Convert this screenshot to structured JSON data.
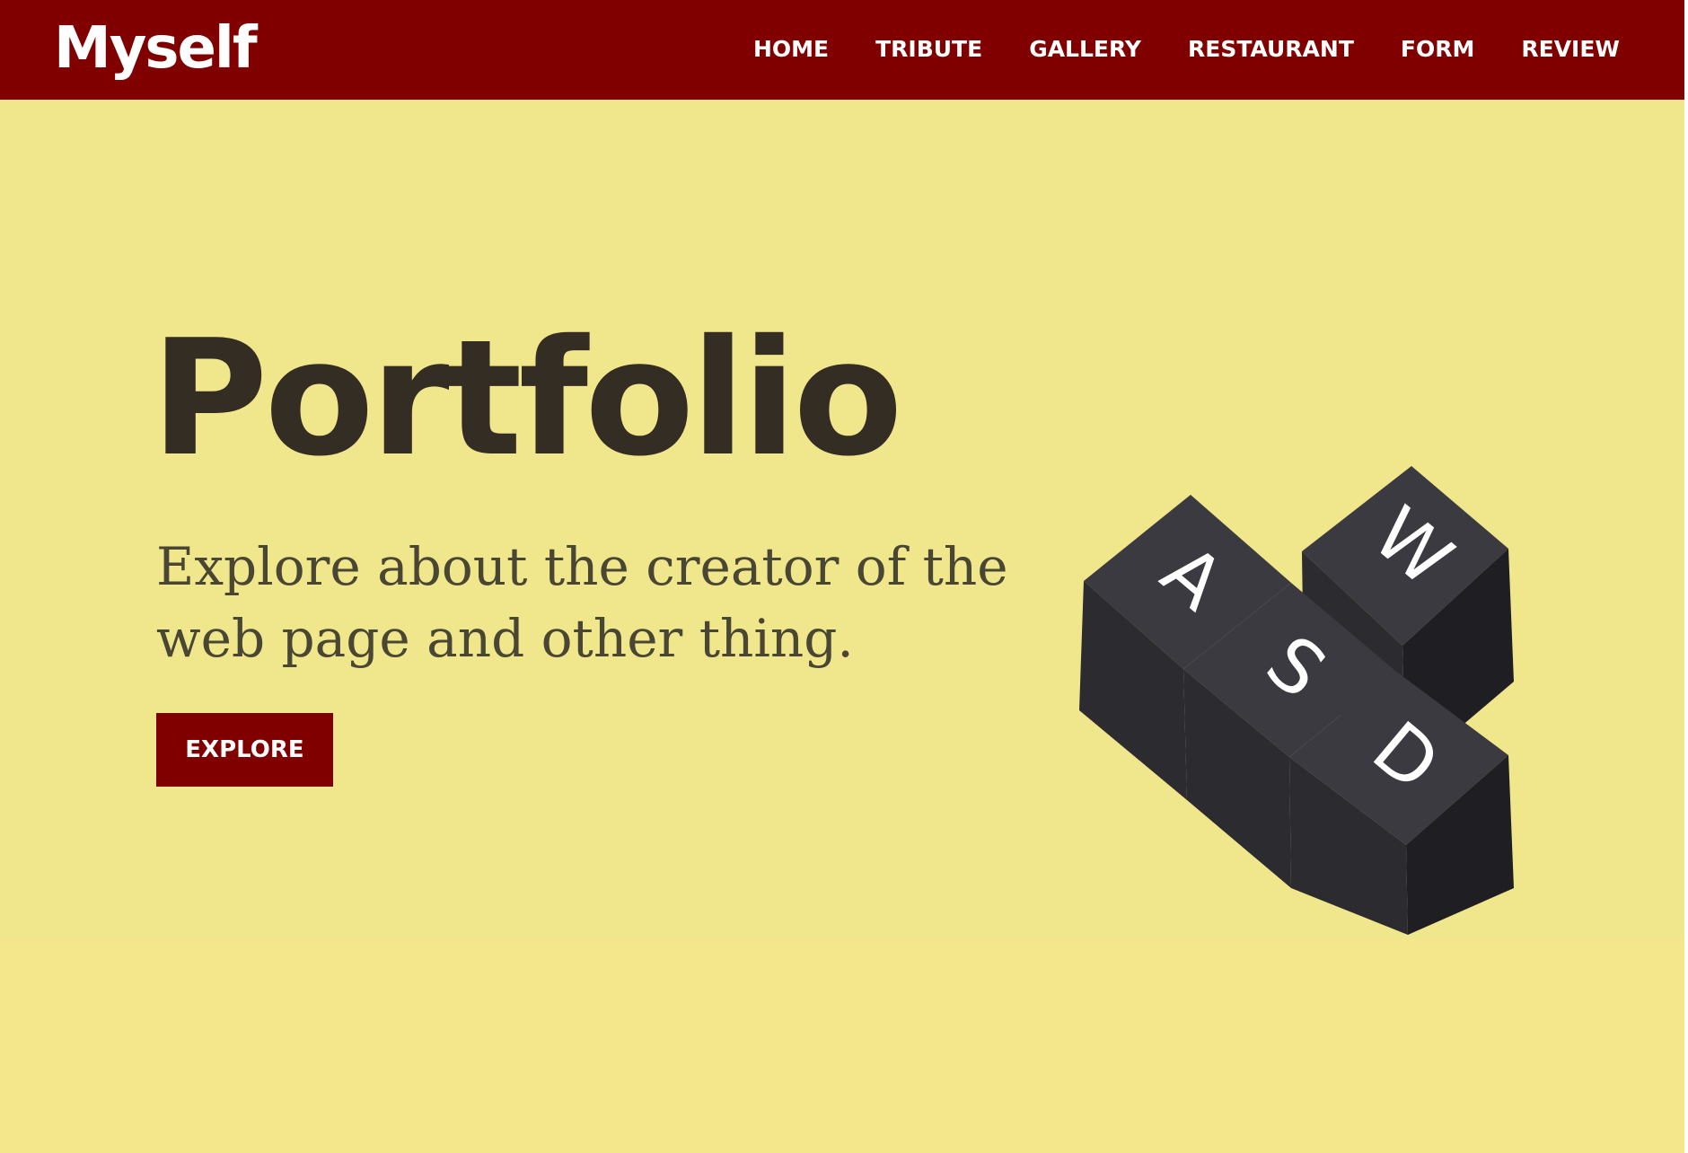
{
  "brand": {
    "name": "Myself"
  },
  "nav": {
    "items": [
      {
        "label": "HOME"
      },
      {
        "label": "TRIBUTE"
      },
      {
        "label": "GALLERY"
      },
      {
        "label": "RESTAURANT"
      },
      {
        "label": "FORM"
      },
      {
        "label": "REVIEW"
      }
    ]
  },
  "hero": {
    "title": "Portfolio",
    "subtitle": "Explore about the creator of the web page and other thing.",
    "button_label": "EXPLORE",
    "illustration": {
      "icon": "keyboard-keys-icon",
      "keys": [
        "W",
        "A",
        "S",
        "D"
      ]
    }
  },
  "colors": {
    "navbar": "#800000",
    "hero_bg": "#f0e68c",
    "page_bg": "#f4e68a",
    "title": "#332d24",
    "subtitle": "#4a4634",
    "button": "#800000",
    "key_top": "#3b3a40",
    "key_side": "#1f1e22"
  }
}
